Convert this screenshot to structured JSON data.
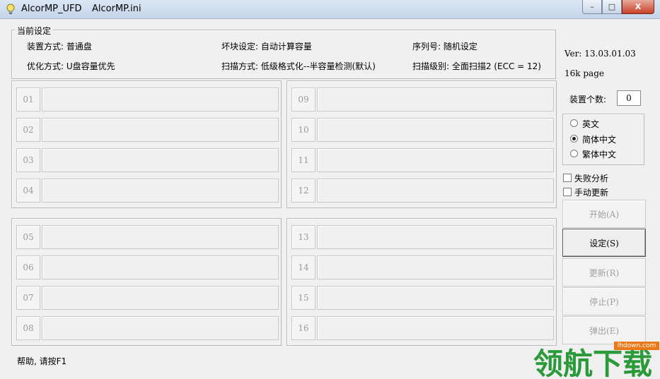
{
  "window": {
    "title_app": "AlcorMP_UFD",
    "title_file": "AlcorMP.ini",
    "min_label": "–",
    "max_label": "□",
    "close_label": "X"
  },
  "settings": {
    "legend": "当前设定",
    "install_mode": "装置方式: 普通盘",
    "bad_block": "坏块设定: 自动计算容量",
    "serial": "序列号: 随机设定",
    "optimize": "优化方式: U盘容量优先",
    "scan_mode": "扫描方式: 低级格式化--半容量检测(默认)",
    "scan_level": "扫描级别: 全面扫描2 (ECC = 12)"
  },
  "slots": [
    "01",
    "02",
    "03",
    "04",
    "05",
    "06",
    "07",
    "08",
    "09",
    "10",
    "11",
    "12",
    "13",
    "14",
    "15",
    "16"
  ],
  "panel": {
    "version": "Ver: 13.03.01.03",
    "page": "16k page",
    "device_count_label": "装置个数:",
    "device_count": "0",
    "languages": [
      {
        "label": "英文",
        "selected": false
      },
      {
        "label": "简体中文",
        "selected": true
      },
      {
        "label": "繁体中文",
        "selected": false
      }
    ],
    "fail_analysis": "失败分析",
    "manual_update": "手动更新",
    "buttons": {
      "start": "开始(A)",
      "settings": "设定(S)",
      "refresh": "更新(R)",
      "stop": "停止(P)",
      "eject": "弹出(E)"
    }
  },
  "status": "帮助, 请按F1",
  "watermark": {
    "url": "lhdown.com",
    "logo_text": "领航下载",
    "color": "#2a9a3a"
  }
}
